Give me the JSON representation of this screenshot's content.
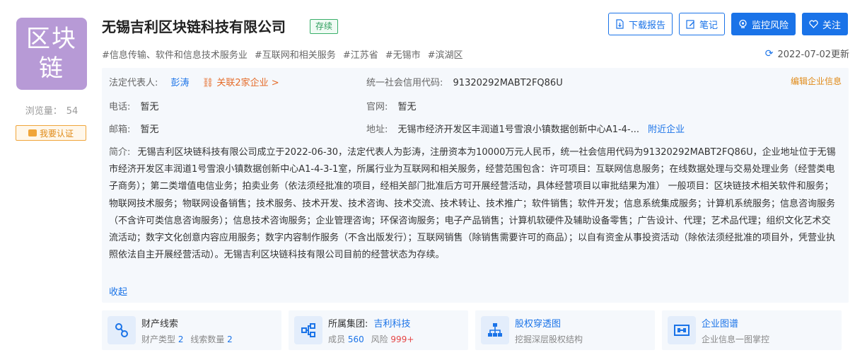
{
  "company": {
    "logo_line1": "区块",
    "logo_line2": "链",
    "name": "无锡吉利区块链科技有限公司",
    "status": "存续",
    "views_label": "浏览量：",
    "views_count": "54",
    "verify_label": "我要认证",
    "tags": [
      "#信息传输、软件和信息技术服务业",
      "#互联网和相关服务",
      "#江苏省",
      "#无锡市",
      "#滨湖区"
    ],
    "updated": "2022-07-02更新"
  },
  "actions": {
    "download": "下载报告",
    "notes": "笔记",
    "monitor": "监控风险",
    "follow": "关注"
  },
  "info": {
    "edit_link": "编辑企业信息",
    "legal_rep_label": "法定代表人:",
    "legal_rep": "彭涛",
    "related": "关联2家企业 >",
    "credit_code_label": "统一社会信用代码:",
    "credit_code": "91320292MABT2FQ86U",
    "phone_label": "电话:",
    "phone": "暂无",
    "website_label": "官网:",
    "website": "暂无",
    "email_label": "邮箱:",
    "email": "暂无",
    "address_label": "地址:",
    "address": "无锡市经济开发区丰润道1号雪浪小镇数据创新中心A1-4-...",
    "nearby": "附近企业",
    "intro_label": "简介:",
    "intro": "无锡吉利区块链科技有限公司成立于2022-06-30，法定代表人为彭涛，注册资本为10000万元人民币，统一社会信用代码为91320292MABT2FQ86U，企业地址位于无锡市经济开发区丰润道1号雪浪小镇数据创新中心A1-4-3-1室，所属行业为互联网和相关服务，经营范围包含：许可项目：互联网信息服务；在线数据处理与交易处理业务（经营类电子商务）；第二类增值电信业务；拍卖业务（依法须经批准的项目，经相关部门批准后方可开展经营活动，具体经营项目以审批结果为准） 一般项目：区块链技术相关软件和服务；物联网技术服务；物联网设备销售；技术服务、技术开发、技术咨询、技术交流、技术转让、技术推广；软件销售；软件开发；信息系统集成服务；计算机系统服务；信息咨询服务（不含许可类信息咨询服务）；信息技术咨询服务；企业管理咨询；环保咨询服务；电子产品销售；计算机软硬件及辅助设备零售；广告设计、代理；艺术品代理；组织文化艺术交流活动；数字文化创意内容应用服务；数字内容制作服务（不含出版发行）；互联网销售（除销售需要许可的商品）；以自有资金从事投资活动（除依法须经批准的项目外，凭营业执照依法自主开展经营活动）。无锡吉利区块链科技有限公司目前的经营状态为存续。",
    "collapse": "收起"
  },
  "cards": [
    {
      "title": "财产线索",
      "sub1_label": "财产类型",
      "sub1_val": "2",
      "sub2_label": "线索数量",
      "sub2_val": "2"
    },
    {
      "title": "所属集团:",
      "title_val": "吉利科技",
      "sub1_label": "成员",
      "sub1_val": "560",
      "sub2_label": "风险",
      "sub2_val": "999+"
    },
    {
      "title": "股权穿透图",
      "sub": "挖掘深层股权结构"
    },
    {
      "title": "企业图谱",
      "sub": "企业信息一图掌控"
    }
  ]
}
